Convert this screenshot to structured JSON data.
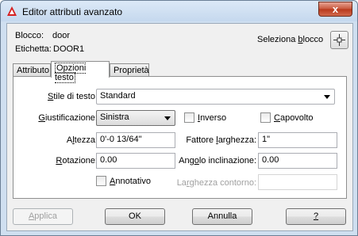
{
  "window": {
    "title": "Editor attributi avanzato",
    "close_label": "x"
  },
  "info": {
    "block_label": "Blocco:",
    "block_value": "door",
    "tag_label": "Etichetta:",
    "tag_value": "DOOR1",
    "select_block_pre": "Seleziona ",
    "select_block_key": "b",
    "select_block_post": "locco"
  },
  "tabs": [
    {
      "label": "Attributo"
    },
    {
      "label": "Opzioni testo"
    },
    {
      "label": "Proprietà"
    }
  ],
  "text_options": {
    "text_style": {
      "pre": "",
      "key": "S",
      "post": "tile di testo:",
      "value": "Standard"
    },
    "justification": {
      "pre": "",
      "key": "G",
      "post": "iustificazione:",
      "value": "Sinistra"
    },
    "backwards": {
      "pre": "",
      "key": "I",
      "post": "nverso"
    },
    "upside_down": {
      "pre": "",
      "key": "C",
      "post": "apovolto"
    },
    "height": {
      "pre": "A",
      "key": "l",
      "post": "tezza:",
      "value": "0'-0 13/64\""
    },
    "width_factor": {
      "pre": "Fattore ",
      "key": "l",
      "post": "arghezza:",
      "value": "1\""
    },
    "rotation": {
      "pre": "",
      "key": "R",
      "post": "otazione:",
      "value": "0.00"
    },
    "oblique": {
      "pre": "Ang",
      "key": "o",
      "post": "lo inclinazione:",
      "value": "0.00"
    },
    "annotative": {
      "pre": "",
      "key": "A",
      "post": "nnotativo"
    },
    "boundary_width": {
      "pre": "La",
      "key": "r",
      "post": "ghezza contorno:",
      "value": ""
    }
  },
  "buttons": {
    "apply_pre": "",
    "apply_key": "A",
    "apply_post": "pplica",
    "ok": "OK",
    "cancel": "Annulla",
    "help_key": "?"
  },
  "colors": {
    "title_bar": "#c5d8ee",
    "close_button": "#c7553a",
    "dialog_bg": "#f0f0f0",
    "panel_bg": "#ffffff"
  }
}
